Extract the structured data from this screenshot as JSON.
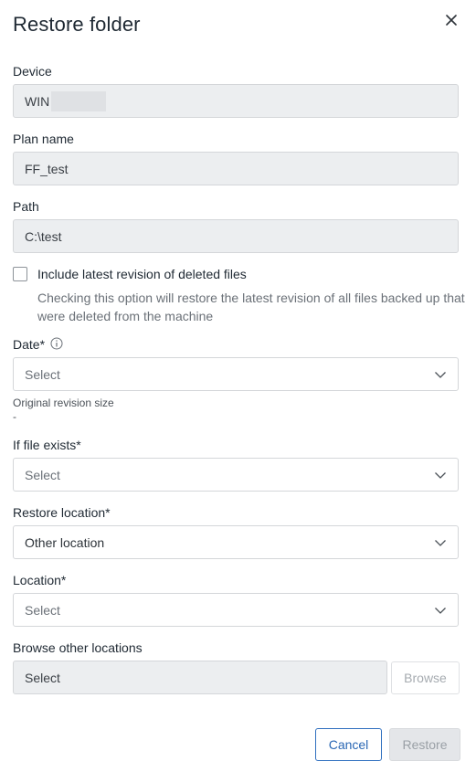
{
  "dialog": {
    "title": "Restore folder",
    "close_icon": "close-icon"
  },
  "device": {
    "label": "Device",
    "value": "WIN"
  },
  "plan": {
    "label": "Plan name",
    "value": "FF_test"
  },
  "path": {
    "label": "Path",
    "value": "C:\\test"
  },
  "include_deleted": {
    "label": "Include latest revision of deleted files",
    "checked": false,
    "help": "Checking this option will restore the latest revision of all files backed up that were deleted from the machine"
  },
  "date": {
    "label": "Date*",
    "value": "Select",
    "info_icon": "info-icon"
  },
  "revision": {
    "label": "Original revision size",
    "value": "-"
  },
  "if_exists": {
    "label": "If file exists*",
    "value": "Select"
  },
  "restore_location": {
    "label": "Restore location*",
    "value": "Other location"
  },
  "location": {
    "label": "Location*",
    "value": "Select"
  },
  "browse": {
    "label": "Browse other locations",
    "value": "Select",
    "button": "Browse"
  },
  "footer": {
    "cancel": "Cancel",
    "restore": "Restore"
  },
  "colors": {
    "accent": "#2a67b4",
    "disabled_bg": "#eceef0",
    "border": "#d4d6d9"
  }
}
